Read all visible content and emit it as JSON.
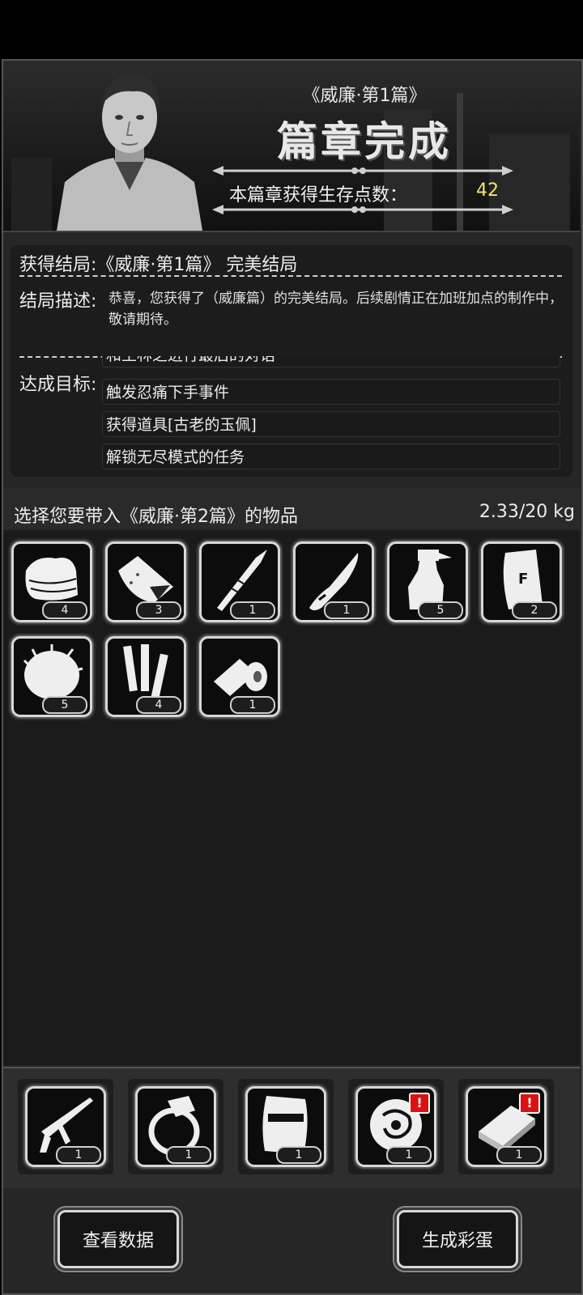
{
  "header": {
    "chapter_subtitle": "《威廉·第1篇》",
    "chapter_title": "篇章完成",
    "points_label": "本篇章获得生存点数：",
    "points_value": "42"
  },
  "ending": {
    "result_label": "获得结局:",
    "result_value": "《威廉·第1篇》 完美结局",
    "description_label": "结局描述:",
    "description_text": "恭喜，您获得了（威廉篇）的完美结局。后续剧情正在加班加点的制作中，敬请期待。",
    "goals_label": "达成目标:",
    "goals": [
      "和王林之进行最后的对话",
      "触发忍痛下手事件",
      "获得道具[古老的玉佩]",
      "解锁无尽模式的任务"
    ]
  },
  "inventory": {
    "title": "选择您要带入《威廉·第2篇》的物品",
    "weight": "2.33/20 kg",
    "items": [
      {
        "icon": "cloth-icon",
        "count": "4"
      },
      {
        "icon": "food-bag-icon",
        "count": "3"
      },
      {
        "icon": "spear-icon",
        "count": "1"
      },
      {
        "icon": "knife-icon",
        "count": "1"
      },
      {
        "icon": "spray-bottle-icon",
        "count": "5"
      },
      {
        "icon": "flour-bag-icon",
        "count": "2"
      },
      {
        "icon": "fur-icon",
        "count": "5"
      },
      {
        "icon": "batteries-icon",
        "count": "4"
      },
      {
        "icon": "bandage-roll-icon",
        "count": "1"
      }
    ]
  },
  "equipment": [
    {
      "icon": "caulk-gun-icon",
      "count": "1",
      "alert": false
    },
    {
      "icon": "ring-icon",
      "count": "1",
      "alert": false
    },
    {
      "icon": "riot-shield-icon",
      "count": "1",
      "alert": false
    },
    {
      "icon": "jade-pendant-icon",
      "count": "1",
      "alert": true
    },
    {
      "icon": "book-icon",
      "count": "1",
      "alert": true
    }
  ],
  "alert_mark": "!",
  "buttons": {
    "view_data": "查看数据",
    "generate_easter_egg": "生成彩蛋"
  }
}
